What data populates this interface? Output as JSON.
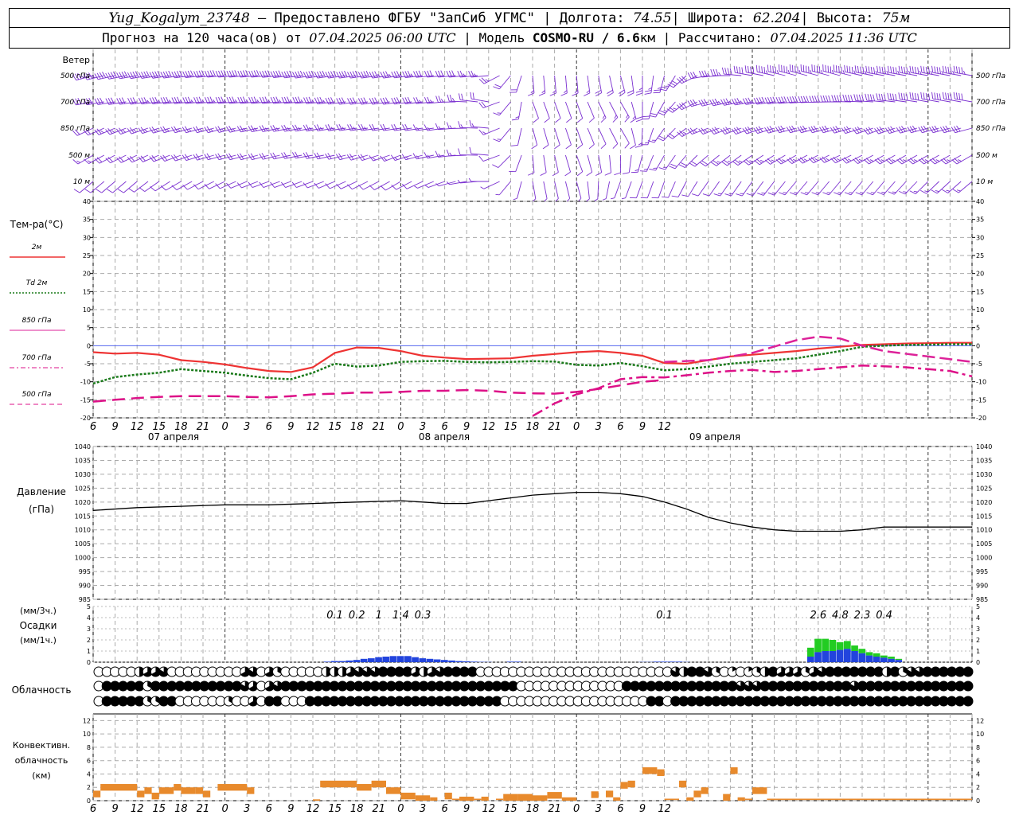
{
  "header": {
    "station": "Yug_Kogalym_23748",
    "provider": " — Предоставлено ФГБУ \"ЗапСиб УГМС\" ",
    "lon_label": " Долгота: ",
    "lon": "74.55",
    "lat_label": " Широта: ",
    "lat": "62.204",
    "alt_label": " Высота: ",
    "alt": "75м",
    "forecast_label": "Прогноз на 120 часа(ов) от ",
    "forecast_time": "07.04.2025 06:00 UTC",
    "model_label": " | Модель ",
    "model": "COSMO-RU / 6.6",
    "model_unit": "км",
    "calc_label": " | Рассчитано: ",
    "calc_time": "07.04.2025 11:36 UTC",
    "sep": "|"
  },
  "labels": {
    "wind_title": "Ветер",
    "wind_levels": [
      "500 гПа",
      "700 гПа",
      "850 гПа",
      "500 м",
      "10  м"
    ],
    "temp_title": "Тем-ра(°С)",
    "temp_legend": [
      "2м",
      "Td  2м",
      "850 гПа",
      "700 гПа",
      "500 гПа"
    ],
    "pressure_title": [
      "Давление",
      "(гПа)"
    ],
    "precip_title": [
      "(мм/3ч.)",
      "Осадки",
      "(мм/1ч.)"
    ],
    "cloud_title": "Облачность",
    "conv_title": [
      "Конвективн.",
      "облачность",
      "(км)"
    ],
    "day_labels": [
      "07 апреля",
      "08 апреля",
      "09 апреля"
    ]
  },
  "colors": {
    "wind": "#7a2fd0",
    "t2m": "#ee3333",
    "td2m": "#1a7a1a",
    "t850": "#dd2299",
    "t700": "#dd1188",
    "t500": "#dd1188",
    "pressure": "#000000",
    "precip_1h": "#2244dd",
    "precip_3h": "#22cc22",
    "conv": "#e88a2c"
  },
  "chart_data": {
    "type": "line",
    "x_hours_ticks": [
      "6",
      "9",
      "12",
      "15",
      "18",
      "21",
      "0",
      "3",
      "6",
      "9",
      "12",
      "15",
      "18",
      "21",
      "0",
      "3",
      "6",
      "9",
      "12",
      "15",
      "18",
      "21",
      "0",
      "3",
      "6",
      "9",
      "12"
    ],
    "temperature": {
      "ylim": [
        -20,
        40
      ],
      "series": [
        {
          "name": "2м",
          "x": [
            0,
            3,
            6,
            9,
            12,
            15,
            18,
            21,
            24,
            27,
            30,
            33,
            36,
            39,
            42,
            45,
            48,
            51,
            54,
            57,
            60,
            63,
            66,
            69,
            72,
            75,
            78,
            81,
            84,
            87,
            90,
            93,
            96,
            99,
            102,
            105,
            108,
            111,
            114,
            117,
            120
          ],
          "values": [
            -1.8,
            -2.2,
            -2.0,
            -2.5,
            -4.0,
            -4.5,
            -5.2,
            -6.2,
            -7.0,
            -7.3,
            -6.0,
            -2.0,
            -0.5,
            -0.6,
            -1.5,
            -2.8,
            -3.3,
            -3.7,
            -3.6,
            -3.5,
            -2.8,
            -2.3,
            -1.8,
            -1.5,
            -2.0,
            -2.8,
            -4.8,
            -5.0,
            -4.0,
            -3.0,
            -2.5,
            -2.0,
            -1.5,
            -0.8,
            -0.3,
            0.2,
            0.4,
            0.6,
            0.7,
            0.8,
            0.8
          ]
        },
        {
          "name": "Td 2м",
          "x": [
            0,
            3,
            6,
            9,
            12,
            15,
            18,
            21,
            24,
            27,
            30,
            33,
            36,
            39,
            42,
            45,
            48,
            51,
            54,
            57,
            60,
            63,
            66,
            69,
            72,
            75,
            78,
            81,
            84,
            87,
            90,
            93,
            96,
            99,
            102,
            105,
            108,
            111,
            114,
            117,
            120
          ],
          "values": [
            -10.5,
            -8.7,
            -8.0,
            -7.5,
            -6.5,
            -7.0,
            -7.5,
            -8.3,
            -9.0,
            -9.3,
            -7.5,
            -5.0,
            -5.8,
            -5.5,
            -4.5,
            -4.3,
            -4.2,
            -4.5,
            -4.6,
            -4.5,
            -4.3,
            -4.4,
            -5.3,
            -5.5,
            -4.8,
            -5.7,
            -6.8,
            -6.5,
            -5.8,
            -5.0,
            -4.5,
            -4.0,
            -3.5,
            -2.5,
            -1.5,
            -0.3,
            0.0,
            0.2,
            0.3,
            0.4,
            0.4
          ]
        },
        {
          "name": "850 гПа",
          "x": [
            78,
            84,
            90,
            96,
            99,
            102,
            105,
            108,
            114,
            120
          ],
          "values": [
            -4.5,
            -4.0,
            -2.0,
            1.5,
            2.5,
            2.0,
            0.0,
            -1.5,
            -3.0,
            -4.5
          ]
        },
        {
          "name": "700 гПа",
          "x": [
            60,
            63,
            66,
            69,
            72,
            75,
            78,
            81,
            84,
            87,
            90,
            93,
            96,
            99,
            102,
            105,
            108,
            111,
            114,
            117,
            120
          ],
          "values": [
            -19.5,
            -16.0,
            -13.5,
            -11.8,
            -9.3,
            -8.7,
            -8.8,
            -8.2,
            -7.5,
            -7.0,
            -6.7,
            -7.3,
            -7.0,
            -6.5,
            -6.0,
            -5.5,
            -5.7,
            -6.0,
            -6.5,
            -7.0,
            -8.5
          ]
        },
        {
          "name": "500 гПа",
          "x": [
            0,
            3,
            6,
            9,
            12,
            15,
            18,
            21,
            24,
            27,
            30,
            33,
            36,
            39,
            42,
            45,
            48,
            51,
            54,
            57,
            60,
            63,
            66,
            69,
            72,
            75,
            78
          ],
          "values": [
            -15.5,
            -15.0,
            -14.5,
            -14.2,
            -14.0,
            -14.0,
            -14.0,
            -14.2,
            -14.3,
            -14.0,
            -13.5,
            -13.3,
            -13.0,
            -13.0,
            -12.8,
            -12.5,
            -12.5,
            -12.3,
            -12.5,
            -13.0,
            -13.2,
            -13.3,
            -12.8,
            -12.0,
            -11.0,
            -10.0,
            -9.5
          ]
        }
      ]
    },
    "pressure": {
      "ylim": [
        985,
        1040
      ],
      "x": [
        0,
        6,
        12,
        18,
        24,
        30,
        36,
        42,
        45,
        48,
        51,
        54,
        57,
        60,
        63,
        66,
        69,
        72,
        75,
        78,
        81,
        84,
        87,
        90,
        93,
        96,
        99,
        102,
        105,
        108,
        111,
        114,
        117,
        120
      ],
      "values": [
        1017.0,
        1018.0,
        1018.5,
        1019.0,
        1019.0,
        1019.5,
        1020.0,
        1020.5,
        1020.0,
        1019.5,
        1019.5,
        1020.5,
        1021.5,
        1022.5,
        1023.0,
        1023.5,
        1023.5,
        1023.0,
        1022.0,
        1020.0,
        1017.5,
        1014.5,
        1012.5,
        1011.0,
        1010.0,
        1009.5,
        1009.5,
        1009.5,
        1010.0,
        1011.0,
        1011.0,
        1011.0,
        1011.0,
        1011.0
      ]
    },
    "precip": {
      "ylim": [
        0,
        5
      ],
      "labels_3h": [
        {
          "x": 33,
          "text": "0.1"
        },
        {
          "x": 36,
          "text": "0.2"
        },
        {
          "x": 39,
          "text": "1"
        },
        {
          "x": 42,
          "text": "1.4"
        },
        {
          "x": 45,
          "text": "0.3"
        },
        {
          "x": 78,
          "text": "0.1"
        },
        {
          "x": 99,
          "text": "2.6"
        },
        {
          "x": 102,
          "text": "4.8"
        },
        {
          "x": 105,
          "text": "2.3"
        },
        {
          "x": 108,
          "text": "0.4"
        }
      ],
      "hourly_x": [
        32,
        33,
        34,
        35,
        36,
        37,
        38,
        39,
        40,
        41,
        42,
        43,
        44,
        45,
        46,
        47,
        48,
        49,
        50,
        51,
        52,
        53,
        54,
        57,
        58,
        75,
        76,
        77,
        78,
        79,
        80,
        81,
        98,
        99,
        100,
        101,
        102,
        103,
        104,
        105,
        106,
        107,
        108,
        109,
        110
      ],
      "hourly": [
        0.05,
        0.1,
        0.1,
        0.15,
        0.2,
        0.3,
        0.35,
        0.45,
        0.5,
        0.55,
        0.55,
        0.55,
        0.45,
        0.35,
        0.3,
        0.25,
        0.2,
        0.15,
        0.1,
        0.08,
        0.05,
        0.03,
        0.02,
        0.05,
        0.05,
        0.02,
        0.02,
        0.05,
        0.05,
        0.05,
        0.05,
        0.02,
        0.5,
        0.9,
        1.0,
        1.0,
        1.1,
        1.2,
        1.0,
        0.8,
        0.6,
        0.5,
        0.4,
        0.3,
        0.2
      ],
      "hourly_3h": [
        0,
        0,
        0,
        0,
        0,
        0,
        0,
        0,
        0,
        0,
        0,
        0,
        0,
        0,
        0,
        0,
        0,
        0,
        0,
        0,
        0,
        0,
        0,
        0,
        0,
        0,
        0,
        0,
        0,
        0,
        0,
        0,
        0.8,
        1.2,
        1.1,
        1.0,
        0.7,
        0.7,
        0.5,
        0.4,
        0.3,
        0.3,
        0.2,
        0.2,
        0.1
      ]
    },
    "cloud_rows": [
      "000003445000000000450420000033345556666434566660000000000000000000000005366520101236444245666666636255666666",
      "066666266666666666540456666666666666666666666666666600000000000006666666666666655566666666666566666666666666",
      "066666226600000020040660006666666666666666666666660000000000000000006606666666666666666666666666666666666666"
    ],
    "convective": {
      "ylim": [
        0,
        13
      ],
      "bars": [
        {
          "x0": 0,
          "x1": 1,
          "v": 1.5
        },
        {
          "x0": 1,
          "x1": 6,
          "v": 2.5
        },
        {
          "x0": 6,
          "x1": 7,
          "v": 1.5
        },
        {
          "x0": 7,
          "x1": 8,
          "v": 2.0
        },
        {
          "x0": 8,
          "x1": 9,
          "v": 1.2
        },
        {
          "x0": 9,
          "x1": 11,
          "v": 2.0
        },
        {
          "x0": 11,
          "x1": 12,
          "v": 2.5
        },
        {
          "x0": 12,
          "x1": 14,
          "v": 2.0
        },
        {
          "x0": 14,
          "x1": 15,
          "v": 2.0
        },
        {
          "x0": 15,
          "x1": 16,
          "v": 1.5
        },
        {
          "x0": 17,
          "x1": 21,
          "v": 2.5
        },
        {
          "x0": 21,
          "x1": 22,
          "v": 2.0
        },
        {
          "x0": 30,
          "x1": 31,
          "v": 0.2
        },
        {
          "x0": 31,
          "x1": 36,
          "v": 3.0
        },
        {
          "x0": 36,
          "x1": 38,
          "v": 2.5
        },
        {
          "x0": 38,
          "x1": 40,
          "v": 3.0
        },
        {
          "x0": 40,
          "x1": 42,
          "v": 2.0
        },
        {
          "x0": 42,
          "x1": 44,
          "v": 1.2
        },
        {
          "x0": 44,
          "x1": 46,
          "v": 0.8
        },
        {
          "x0": 46,
          "x1": 47,
          "v": 0.5
        },
        {
          "x0": 48,
          "x1": 49,
          "v": 1.2
        },
        {
          "x0": 49,
          "x1": 50,
          "v": 0.3
        },
        {
          "x0": 50,
          "x1": 52,
          "v": 0.6
        },
        {
          "x0": 52,
          "x1": 53,
          "v": 0.3
        },
        {
          "x0": 53,
          "x1": 54,
          "v": 0.6
        },
        {
          "x0": 55,
          "x1": 56,
          "v": 0.3
        },
        {
          "x0": 56,
          "x1": 58,
          "v": 1.0
        },
        {
          "x0": 58,
          "x1": 60,
          "v": 1.0
        },
        {
          "x0": 60,
          "x1": 62,
          "v": 0.8
        },
        {
          "x0": 62,
          "x1": 64,
          "v": 1.3
        },
        {
          "x0": 64,
          "x1": 66,
          "v": 0.5
        },
        {
          "x0": 68,
          "x1": 69,
          "v": 1.4
        },
        {
          "x0": 70,
          "x1": 71,
          "v": 1.5
        },
        {
          "x0": 71,
          "x1": 72,
          "v": 0.5
        },
        {
          "x0": 72,
          "x1": 73,
          "v": 2.8
        },
        {
          "x0": 73,
          "x1": 74,
          "v": 3.0
        },
        {
          "x0": 75,
          "x1": 77,
          "v": 5.0
        },
        {
          "x0": 77,
          "x1": 78,
          "v": 4.7
        },
        {
          "x0": 78,
          "x1": 80,
          "v": 0.3
        },
        {
          "x0": 80,
          "x1": 81,
          "v": 3.0
        },
        {
          "x0": 81,
          "x1": 82,
          "v": 0.5
        },
        {
          "x0": 82,
          "x1": 83,
          "v": 1.5
        },
        {
          "x0": 83,
          "x1": 84,
          "v": 2.0
        },
        {
          "x0": 86,
          "x1": 87,
          "v": 1.0
        },
        {
          "x0": 87,
          "x1": 88,
          "v": 5.0
        },
        {
          "x0": 88,
          "x1": 89,
          "v": 0.5
        },
        {
          "x0": 89,
          "x1": 90,
          "v": 0.3
        },
        {
          "x0": 90,
          "x1": 92,
          "v": 2.0
        },
        {
          "x0": 92,
          "x1": 120,
          "v": 0.3
        }
      ]
    },
    "wind": {
      "levels": [
        "500 гПа",
        "700 гПа",
        "850 гПа",
        "500 м",
        "10  м"
      ],
      "x": [
        0,
        6,
        12,
        18,
        24,
        30,
        36,
        42,
        48,
        54,
        60,
        66,
        72,
        78,
        84,
        90,
        96,
        102,
        108,
        114,
        120
      ],
      "dir": [
        [
          255,
          260,
          262,
          265,
          265,
          262,
          262,
          262,
          265,
          265,
          175,
          175,
          165,
          195,
          260,
          280,
          285,
          285,
          280,
          280,
          280
        ],
        [
          260,
          262,
          264,
          265,
          265,
          265,
          262,
          262,
          265,
          280,
          160,
          160,
          150,
          210,
          255,
          260,
          265,
          270,
          275,
          280,
          280
        ],
        [
          245,
          250,
          255,
          255,
          258,
          260,
          262,
          262,
          262,
          275,
          165,
          160,
          150,
          215,
          250,
          250,
          255,
          255,
          250,
          255,
          255
        ],
        [
          240,
          245,
          250,
          255,
          255,
          260,
          255,
          250,
          260,
          275,
          175,
          160,
          180,
          210,
          230,
          235,
          240,
          245,
          240,
          240,
          240
        ],
        [
          230,
          230,
          240,
          245,
          250,
          250,
          245,
          240,
          250,
          270,
          170,
          165,
          200,
          200,
          215,
          215,
          220,
          220,
          220,
          225,
          230
        ]
      ],
      "spd": [
        [
          35,
          40,
          40,
          40,
          40,
          40,
          40,
          35,
          30,
          25,
          15,
          15,
          20,
          25,
          30,
          40,
          45,
          45,
          45,
          45,
          45
        ],
        [
          30,
          30,
          35,
          35,
          35,
          35,
          30,
          30,
          25,
          20,
          10,
          10,
          15,
          20,
          30,
          35,
          40,
          40,
          40,
          40,
          40
        ],
        [
          20,
          25,
          25,
          25,
          25,
          25,
          25,
          20,
          15,
          15,
          10,
          10,
          10,
          15,
          25,
          30,
          30,
          30,
          30,
          30,
          30
        ],
        [
          15,
          20,
          20,
          20,
          20,
          20,
          20,
          15,
          15,
          10,
          10,
          10,
          10,
          15,
          20,
          25,
          25,
          25,
          25,
          25,
          25
        ],
        [
          10,
          10,
          10,
          10,
          10,
          10,
          10,
          10,
          5,
          5,
          5,
          5,
          5,
          10,
          10,
          15,
          15,
          15,
          15,
          15,
          15
        ]
      ]
    }
  }
}
